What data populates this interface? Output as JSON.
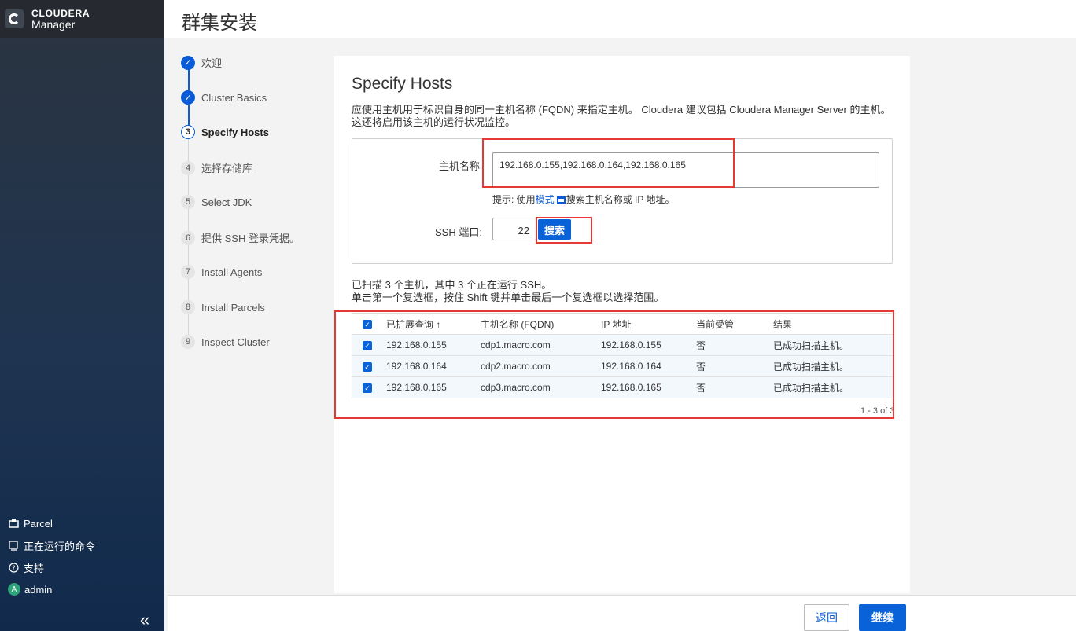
{
  "brand": {
    "name": "CLOUDERA",
    "sub": "Manager"
  },
  "page_title": "群集安装",
  "steps": [
    {
      "num": "✓",
      "label": "欢迎",
      "state": "done"
    },
    {
      "num": "✓",
      "label": "Cluster Basics",
      "state": "done"
    },
    {
      "num": "3",
      "label": "Specify Hosts",
      "state": "current"
    },
    {
      "num": "4",
      "label": "选择存储库",
      "state": "todo"
    },
    {
      "num": "5",
      "label": "Select JDK",
      "state": "todo"
    },
    {
      "num": "6",
      "label": "提供 SSH 登录凭据。",
      "state": "todo"
    },
    {
      "num": "7",
      "label": "Install Agents",
      "state": "todo"
    },
    {
      "num": "8",
      "label": "Install Parcels",
      "state": "todo"
    },
    {
      "num": "9",
      "label": "Inspect Cluster",
      "state": "todo"
    }
  ],
  "sidebar_bottom": [
    {
      "icon": "parcel-icon",
      "label": "Parcel"
    },
    {
      "icon": "running-commands-icon",
      "label": "正在运行的命令"
    },
    {
      "icon": "help-icon",
      "label": "支持"
    },
    {
      "icon": "avatar",
      "label": "admin",
      "initial": "A"
    }
  ],
  "main": {
    "heading": "Specify Hosts",
    "description": "应使用主机用于标识自身的同一主机名称 (FQDN) 来指定主机。 Cloudera 建议包括 Cloudera Manager Server 的主机。这还将启用该主机的运行状况监控。",
    "hostname_label": "主机名称",
    "hostname_value": "192.168.0.155,192.168.0.164,192.168.0.165",
    "hint_prefix": "提示: 使用",
    "hint_link": "模式",
    "hint_suffix": "搜索主机名称或 IP 地址。",
    "ssh_label": "SSH 端口:",
    "ssh_port": "22",
    "search_button": "搜索",
    "scan_line1": "已扫描 3 个主机，其中 3 个正在运行 SSH。",
    "scan_line2": "单击第一个复选框，按住 Shift 键并单击最后一个复选框以选择范围。",
    "table": {
      "headers": [
        "已扩展查询",
        "主机名称 (FQDN)",
        "IP 地址",
        "当前受管",
        "结果"
      ],
      "sort_indicator": "↑",
      "rows": [
        {
          "query": "192.168.0.155",
          "fqdn": "cdp1.macro.com",
          "ip": "192.168.0.155",
          "managed": "否",
          "result": "已成功扫描主机。"
        },
        {
          "query": "192.168.0.164",
          "fqdn": "cdp2.macro.com",
          "ip": "192.168.0.164",
          "managed": "否",
          "result": "已成功扫描主机。"
        },
        {
          "query": "192.168.0.165",
          "fqdn": "cdp3.macro.com",
          "ip": "192.168.0.165",
          "managed": "否",
          "result": "已成功扫描主机。"
        }
      ],
      "pager": "1 - 3 of 3"
    }
  },
  "footer": {
    "back": "返回",
    "next": "继续"
  },
  "colors": {
    "accent": "#0a62d8",
    "highlight": "#e53935"
  }
}
